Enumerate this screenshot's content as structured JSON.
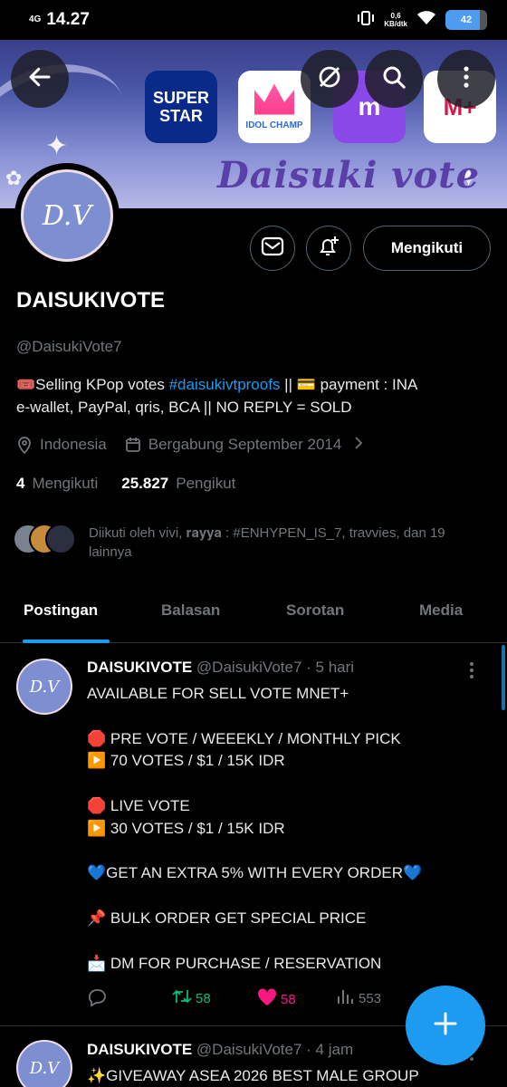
{
  "status_bar": {
    "network": "4G",
    "time": "14.27",
    "speed_value": "0,6",
    "speed_unit": "KB/dtk",
    "battery": "42"
  },
  "banner": {
    "title": "Daisuki vote",
    "apps": [
      {
        "label": "SUPER STAR"
      },
      {
        "label": "IDOL CHAMP"
      },
      {
        "label": "m"
      },
      {
        "label": "M+"
      }
    ]
  },
  "avatar": {
    "monogram": "D.V"
  },
  "profile": {
    "follow_button": "Mengikuti",
    "display_name": "DAISUKIVOTE",
    "handle": "@DaisukiVote7",
    "bio_line1_prefix": "🎟️Selling KPop votes ",
    "bio_hashtag": "#daisukivtproofs",
    "bio_line1_suffix": " || 💳 payment : INA",
    "bio_line2": "e-wallet, PayPal, qris, BCA || NO REPLY = SOLD",
    "location": "Indonesia",
    "joined": "Bergabung September 2014",
    "following_count": "4",
    "following_label": "Mengikuti",
    "followers_count": "25.827",
    "followers_label": "Pengikut",
    "followed_by": "Diikuti oleh vivi, 𝐫𝐚𝐲𝐲𝐚 : #ENHYPEN_IS_7, travvies, dan 19 lainnya"
  },
  "tabs": [
    {
      "label": "Postingan",
      "active": true
    },
    {
      "label": "Balasan",
      "active": false
    },
    {
      "label": "Sorotan",
      "active": false
    },
    {
      "label": "Media",
      "active": false
    }
  ],
  "posts": [
    {
      "name": "DAISUKIVOTE",
      "handle": "@DaisukiVote7",
      "time": "· 5 hari",
      "body": "AVAILABLE FOR SELL VOTE MNET+\n\n🛑 PRE VOTE / WEEEKLY / MONTHLY PICK\n▶️ 70 VOTES / $1 / 15K IDR\n\n🛑 LIVE VOTE\n▶️ 30 VOTES / $1 / 15K IDR\n\n💙GET AN EXTRA 5% WITH EVERY ORDER💙\n\n📌 BULK ORDER GET SPECIAL PRICE\n\n📩 DM FOR PURCHASE / RESERVATION",
      "retweets": "58",
      "likes": "58",
      "views": "553"
    },
    {
      "name": "DAISUKIVOTE",
      "handle": "@DaisukiVote7",
      "time": "· 4 jam",
      "body": "✨GIVEAWAY ASEA 2026 BEST MALE GROUP"
    }
  ],
  "colors": {
    "accent": "#1d9bf0",
    "retweet": "#00ba7c",
    "like": "#f91880",
    "muted": "#71767b"
  }
}
